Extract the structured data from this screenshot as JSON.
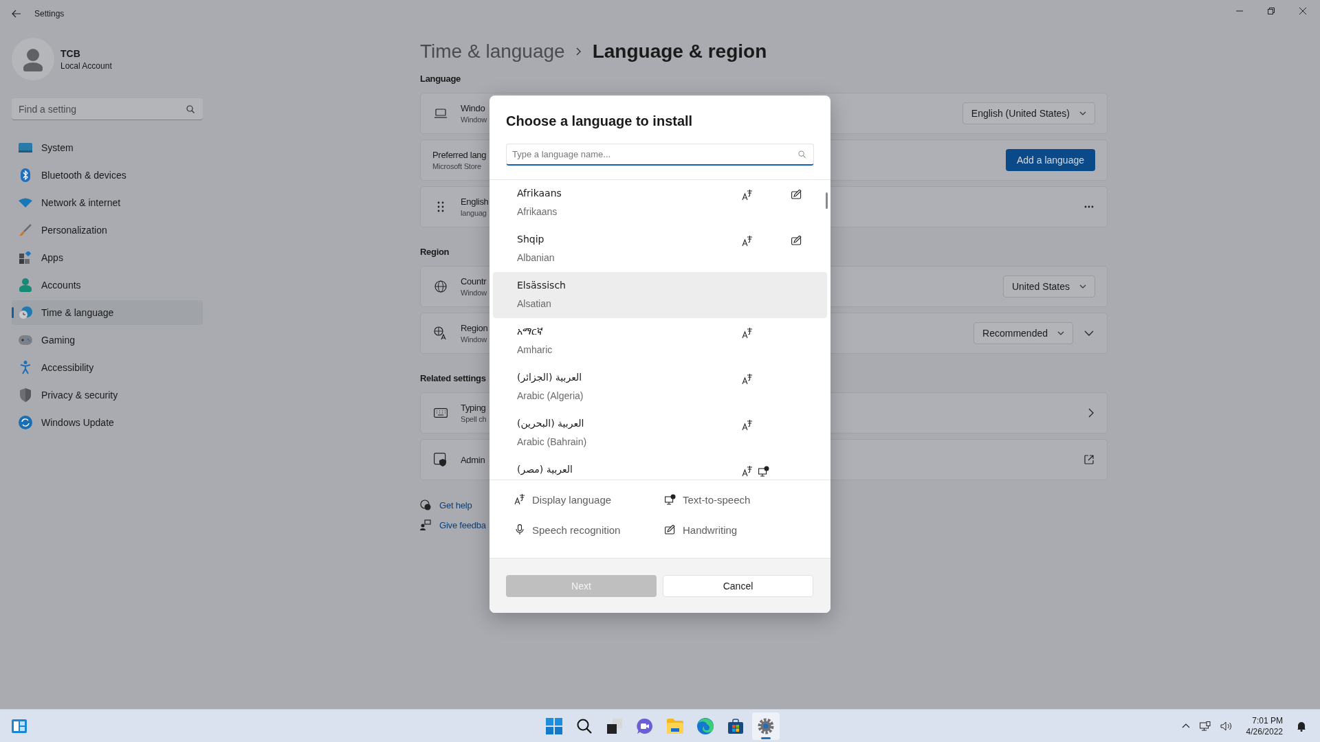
{
  "window": {
    "title": "Settings"
  },
  "account": {
    "name": "TCB",
    "type": "Local Account"
  },
  "sidebar": {
    "search": {
      "placeholder": "Find a setting"
    },
    "items": [
      {
        "label": "System",
        "selected": false
      },
      {
        "label": "Bluetooth & devices",
        "selected": false
      },
      {
        "label": "Network & internet",
        "selected": false
      },
      {
        "label": "Personalization",
        "selected": false
      },
      {
        "label": "Apps",
        "selected": false
      },
      {
        "label": "Accounts",
        "selected": false
      },
      {
        "label": "Time & language",
        "selected": true
      },
      {
        "label": "Gaming",
        "selected": false
      },
      {
        "label": "Accessibility",
        "selected": false
      },
      {
        "label": "Privacy & security",
        "selected": false
      },
      {
        "label": "Windows Update",
        "selected": false
      }
    ]
  },
  "breadcrumb": {
    "parent": "Time & language",
    "current": "Language & region"
  },
  "sections": [
    {
      "heading": "Language",
      "cards": [
        {
          "title": "Windo",
          "subtitle": "Window",
          "controls": [
            {
              "kind": "dropdown",
              "value": "English (United States)"
            }
          ]
        },
        {
          "title": "Preferred lang",
          "subtitle": "Microsoft Store",
          "controls": [
            {
              "kind": "button",
              "value": "Add a language"
            }
          ]
        },
        {
          "title": "English",
          "subtitle": "languag",
          "controls": [
            {
              "kind": "more"
            }
          ]
        }
      ]
    },
    {
      "heading": "Region",
      "cards": [
        {
          "title": "Countr",
          "subtitle": "Window",
          "controls": [
            {
              "kind": "dropdown",
              "value": "United States"
            }
          ]
        },
        {
          "title": "Region",
          "subtitle": "Window",
          "controls": [
            {
              "kind": "dropdown",
              "value": "Recommended"
            },
            {
              "kind": "expand"
            }
          ]
        }
      ]
    },
    {
      "heading": "Related settings",
      "cards": [
        {
          "title": "Typing",
          "subtitle": "Spell ch",
          "controls": [
            {
              "kind": "chevron"
            }
          ]
        },
        {
          "title": "Admin",
          "controls": [
            {
              "kind": "external"
            }
          ]
        }
      ]
    }
  ],
  "help_links": [
    {
      "label": "Get help"
    },
    {
      "label": "Give feedba"
    }
  ],
  "dialog": {
    "title": "Choose a language to install",
    "search": {
      "placeholder": "Type a language name..."
    },
    "languages": [
      {
        "name": "Afrikaans",
        "english": "Afrikaans",
        "selected": false,
        "display_language": true,
        "text_to_speech": false,
        "speech_recognition": false,
        "handwriting": true
      },
      {
        "name": "Shqip",
        "english": "Albanian",
        "selected": false,
        "display_language": true,
        "text_to_speech": false,
        "speech_recognition": false,
        "handwriting": true
      },
      {
        "name": "Elsässisch",
        "english": "Alsatian",
        "selected": true,
        "display_language": false,
        "text_to_speech": false,
        "speech_recognition": false,
        "handwriting": false
      },
      {
        "name": "አማርኛ",
        "english": "Amharic",
        "selected": false,
        "display_language": true,
        "text_to_speech": false,
        "speech_recognition": false,
        "handwriting": false
      },
      {
        "name": "العربية (الجزائر)",
        "english": "Arabic (Algeria)",
        "selected": false,
        "display_language": true,
        "text_to_speech": false,
        "speech_recognition": false,
        "handwriting": false
      },
      {
        "name": "العربية (البحرين)",
        "english": "Arabic (Bahrain)",
        "selected": false,
        "display_language": true,
        "text_to_speech": false,
        "speech_recognition": false,
        "handwriting": false
      },
      {
        "name": "العربية (مصر)",
        "selected": false,
        "display_language": true,
        "text_to_speech": true,
        "speech_recognition": false,
        "handwriting": false
      }
    ],
    "legend": [
      {
        "kind": "display_language",
        "label": "Display language"
      },
      {
        "kind": "text_to_speech",
        "label": "Text-to-speech"
      },
      {
        "kind": "speech_recognition",
        "label": "Speech recognition"
      },
      {
        "kind": "handwriting",
        "label": "Handwriting"
      }
    ],
    "buttons": [
      {
        "label": "Next",
        "disabled": true
      },
      {
        "label": "Cancel",
        "disabled": false
      }
    ]
  },
  "taskbar": {
    "apps": [
      {
        "active": false
      },
      {
        "active": false
      },
      {
        "active": false
      },
      {
        "active": false
      },
      {
        "active": false
      },
      {
        "active": false
      },
      {
        "active": false
      },
      {
        "active": true
      }
    ],
    "tray": {
      "time": "7:01 PM",
      "date": "4/26/2022"
    }
  }
}
